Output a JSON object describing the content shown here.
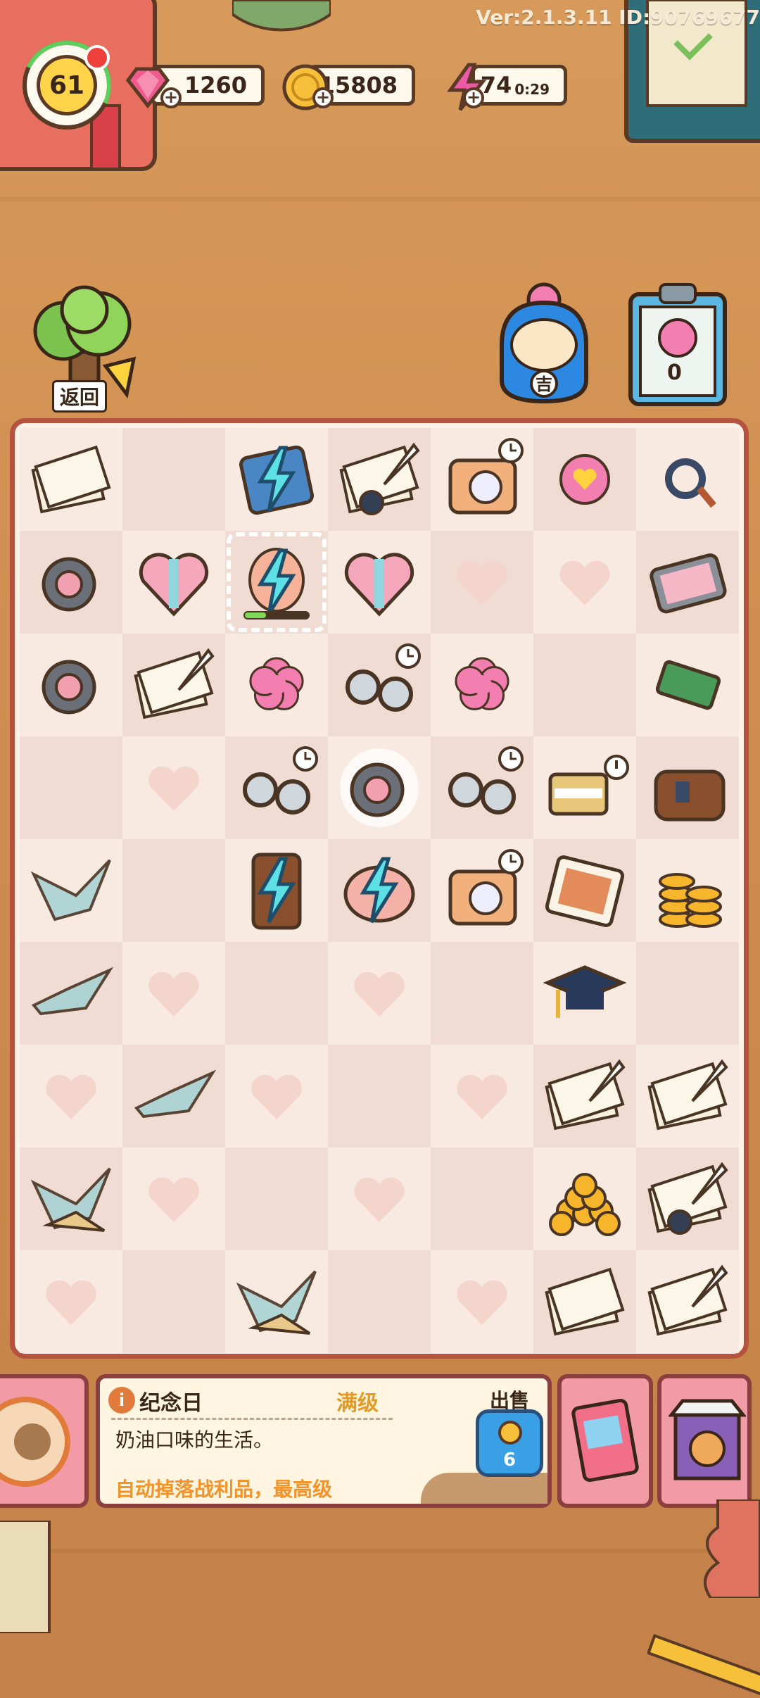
{
  "version": "Ver:2.1.3.11 ID:90769677",
  "level": {
    "value": "61"
  },
  "resources": {
    "gems": {
      "icon": "gem-icon",
      "value": "1260"
    },
    "coins": {
      "icon": "coin-icon",
      "value": "15808"
    },
    "energy": {
      "icon": "lightning-icon",
      "value": "74",
      "timer": "0:29"
    }
  },
  "back_button": {
    "icon": "tree-icon",
    "label": "返回"
  },
  "daruma": {
    "icon": "daruma-cat-icon",
    "badge": "吉"
  },
  "clipboard": {
    "icon": "sakura-clipboard-icon",
    "count": "0"
  },
  "board": {
    "cells": [
      [
        "letters",
        "",
        "lightning-book",
        "quill-ink",
        "camera-timer",
        "sakura-heart",
        "cable"
      ],
      [
        "round-device",
        "gift-heart",
        "lightning-feather-selected",
        "gift-heart",
        "heart",
        "heart",
        "pink-tablet"
      ],
      [
        "round-device",
        "quill-letter",
        "sakura",
        "glasses-timer",
        "sakura",
        "",
        "circuit-board"
      ],
      [
        "",
        "heart",
        "glasses-timer",
        "round-device-glow",
        "glasses-timer",
        "piano-alert",
        "bag"
      ],
      [
        "paper-crane",
        "",
        "lightning-cabinet",
        "lightning-piggy",
        "camera-timer",
        "photo-frame",
        "coin-stack"
      ],
      [
        "paper-crane-2",
        "heart",
        "",
        "heart",
        "",
        "grad-cap",
        ""
      ],
      [
        "heart",
        "paper-crane-2",
        "heart",
        "",
        "heart",
        "quill-letter",
        "quill-letter"
      ],
      [
        "paper-crane-3",
        "heart",
        "",
        "heart",
        "",
        "coin-pile",
        "quill-ink"
      ],
      [
        "heart",
        "",
        "paper-crane-3",
        "",
        "heart",
        "letters",
        "quill-letter"
      ]
    ]
  },
  "info_panel": {
    "icon": "info-icon",
    "icon_text": "i",
    "item_name": "纪念日",
    "max_label": "满级",
    "description": "奶油口味的生活。",
    "effect": "自动掉落战利品，最高级",
    "sell_label": "出售",
    "sell_price": "6"
  },
  "bottom_buttons": {
    "book": "storybook-icon",
    "shop": "corgi-shop-icon"
  },
  "colors": {
    "board_border": "#b5533f",
    "cell_light": "#f8e9e1",
    "cell_dark": "#f0dcd2",
    "accent_orange": "#f29227",
    "max_gold": "#e39a24",
    "sell_blue": "#3aa0e6"
  }
}
